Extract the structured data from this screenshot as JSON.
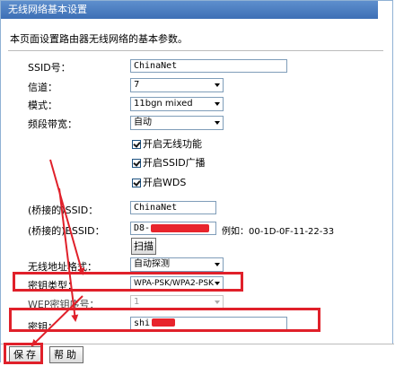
{
  "window": {
    "title": "无线网络基本设置"
  },
  "intro": "本页面设置路由器无线网络的基本参数。",
  "form": {
    "ssid": {
      "label": "SSID号：",
      "value": "ChinaNet"
    },
    "channel": {
      "label": "信道：",
      "value": "7"
    },
    "mode": {
      "label": "模式：",
      "value": "11bgn mixed"
    },
    "bandwidth": {
      "label": "频段带宽：",
      "value": "自动"
    },
    "checkboxes": [
      {
        "label": "开启无线功能",
        "checked": true
      },
      {
        "label": "开启SSID广播",
        "checked": true
      },
      {
        "label": "开启WDS",
        "checked": true
      }
    ],
    "bridged_ssid": {
      "label": "(桥接的)SSID：",
      "value": "ChinaNet"
    },
    "bridged_bssid": {
      "label": "(桥接的)BSSID：",
      "value": "D8-",
      "example": "例如：00-1D-0F-11-22-33"
    },
    "scan_button": "扫描",
    "address_format": {
      "label": "无线地址格式：",
      "value": "自动探测"
    },
    "key_type": {
      "label": "密钥类型：",
      "value": "WPA-PSK/WPA2-PSK"
    },
    "wep_index": {
      "label": "WEP密钥序号：",
      "value": "1"
    },
    "key": {
      "label": "密钥：",
      "value": "shi"
    }
  },
  "buttons": {
    "save": "保存",
    "help": "帮助"
  },
  "colors": {
    "title_bar": "#4a7fc4",
    "annotation": "#e0202a"
  }
}
